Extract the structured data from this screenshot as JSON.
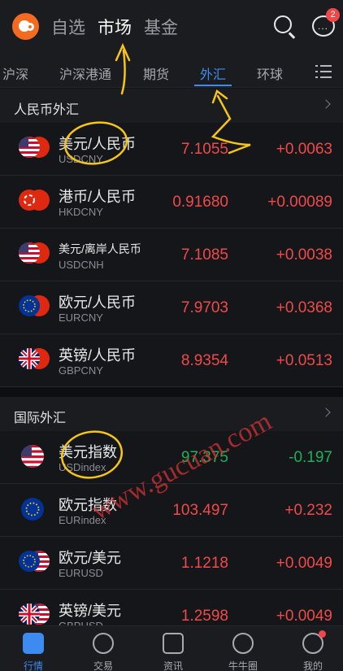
{
  "header": {
    "tabs": [
      "自选",
      "市场",
      "基金"
    ],
    "message_badge": "2"
  },
  "subtabs": [
    "沪深",
    "沪深港通",
    "期货",
    "外汇",
    "环球"
  ],
  "sections": [
    {
      "title": "人民币外汇",
      "rows": [
        {
          "name": "美元/人民币",
          "code": "USDCNY",
          "price": "7.1055",
          "change": "+0.0063"
        },
        {
          "name": "港币/人民币",
          "code": "HKDCNY",
          "price": "0.91680",
          "change": "+0.00089"
        },
        {
          "name": "美元/离岸人民币",
          "code": "USDCNH",
          "price": "7.1085",
          "change": "+0.0038"
        },
        {
          "name": "欧元/人民币",
          "code": "EURCNY",
          "price": "7.9703",
          "change": "+0.0368"
        },
        {
          "name": "英镑/人民币",
          "code": "GBPCNY",
          "price": "8.9354",
          "change": "+0.0513"
        }
      ]
    },
    {
      "title": "国际外汇",
      "rows": [
        {
          "name": "美元指数",
          "code": "USDindex",
          "price": "97.375",
          "change": "-0.197"
        },
        {
          "name": "欧元指数",
          "code": "EURindex",
          "price": "103.497",
          "change": "+0.232"
        },
        {
          "name": "欧元/美元",
          "code": "EURUSD",
          "price": "1.1218",
          "change": "+0.0049"
        },
        {
          "name": "英镑/美元",
          "code": "GBPUSD",
          "price": "1.2598",
          "change": "+0.0049"
        }
      ]
    }
  ],
  "watermark": "www.gucuan.com",
  "bottom_nav": [
    "行情",
    "交易",
    "资讯",
    "牛牛圈",
    "我的"
  ],
  "colors": {
    "up": "#f04a4a",
    "down": "#1db15a",
    "accent": "#3d8bf0",
    "annotation": "#f5c518"
  }
}
